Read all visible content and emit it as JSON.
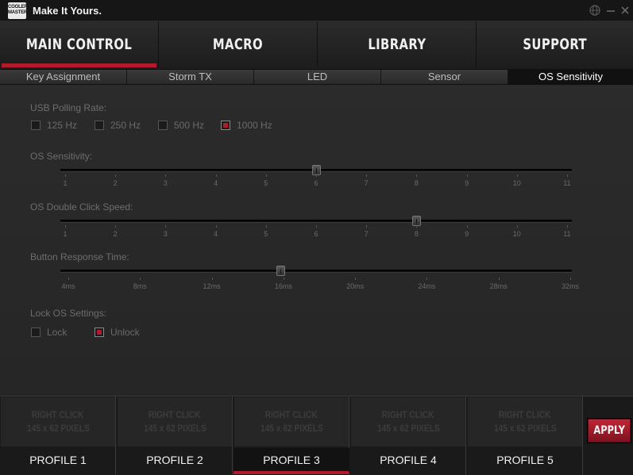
{
  "titlebar": {
    "logo": "COOLER MASTER",
    "tagline": "Make It Yours.",
    "icons": [
      "globe-icon",
      "minimize-icon",
      "close-icon"
    ]
  },
  "main_nav": {
    "items": [
      {
        "label": "MAIN CONTROL",
        "active": true
      },
      {
        "label": "MACRO",
        "active": false
      },
      {
        "label": "LIBRARY",
        "active": false
      },
      {
        "label": "SUPPORT",
        "active": false
      }
    ]
  },
  "sub_tabs": {
    "items": [
      {
        "label": "Key Assignment",
        "active": false
      },
      {
        "label": "Storm TX",
        "active": false
      },
      {
        "label": "LED",
        "active": false
      },
      {
        "label": "Sensor",
        "active": false
      },
      {
        "label": "OS Sensitivity",
        "active": true
      }
    ]
  },
  "polling": {
    "label": "USB Polling Rate:",
    "options": [
      {
        "label": "125 Hz",
        "checked": false
      },
      {
        "label": "250 Hz",
        "checked": false
      },
      {
        "label": "500 Hz",
        "checked": false
      },
      {
        "label": "1000 Hz",
        "checked": true
      }
    ]
  },
  "sliders": [
    {
      "label": "OS Sensitivity:",
      "ticks": [
        "1",
        "2",
        "3",
        "4",
        "5",
        "6",
        "7",
        "8",
        "9",
        "10",
        "11"
      ],
      "value_index": 5
    },
    {
      "label": "OS Double Click Speed:",
      "ticks": [
        "1",
        "2",
        "3",
        "4",
        "5",
        "6",
        "7",
        "8",
        "9",
        "10",
        "11"
      ],
      "value_index": 7
    },
    {
      "label": "Button Response Time:",
      "ticks": [
        "4ms",
        "8ms",
        "12ms",
        "16ms",
        "20ms",
        "24ms",
        "28ms",
        "32ms"
      ],
      "value_index": 3
    }
  ],
  "lock": {
    "label": "Lock OS Settings:",
    "options": [
      {
        "label": "Lock",
        "checked": false
      },
      {
        "label": "Unlock",
        "checked": true
      }
    ]
  },
  "profiles": {
    "placeholder_line1": "RIGHT CLICK",
    "placeholder_line2": "145 x 62 PIXELS",
    "items": [
      {
        "label": "PROFILE 1",
        "active": false
      },
      {
        "label": "PROFILE 2",
        "active": false
      },
      {
        "label": "PROFILE 3",
        "active": true
      },
      {
        "label": "PROFILE 4",
        "active": false
      },
      {
        "label": "PROFILE 5",
        "active": false
      }
    ],
    "apply_label": "APPLY"
  },
  "colors": {
    "accent": "#b31b2c",
    "background": "#262626"
  }
}
